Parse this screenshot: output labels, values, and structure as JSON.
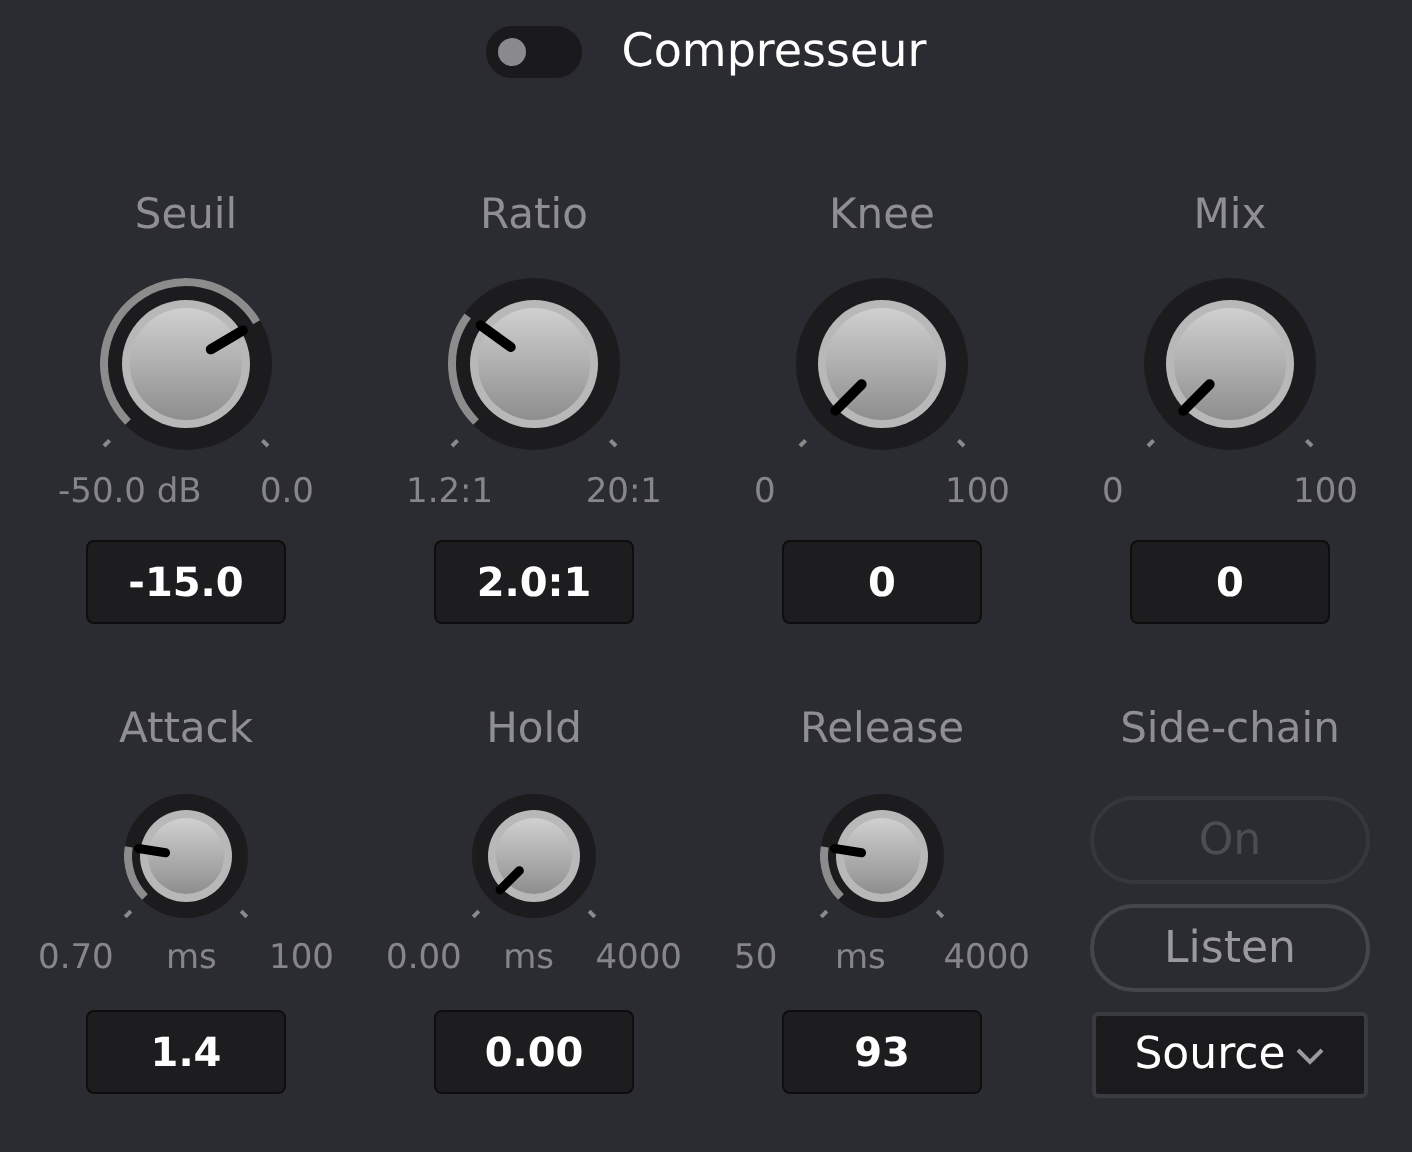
{
  "header": {
    "enabled": false,
    "title": "Compresseur"
  },
  "knobs_top": [
    {
      "label": "Seuil",
      "min": "-50.0 dB",
      "max": "0.0",
      "value": "-15.0"
    },
    {
      "label": "Ratio",
      "min": "1.2:1",
      "max": "20:1",
      "value": "2.0:1"
    },
    {
      "label": "Knee",
      "min": "0",
      "max": "100",
      "value": "0"
    },
    {
      "label": "Mix",
      "min": "0",
      "max": "100",
      "value": "0"
    }
  ],
  "knobs_bottom": [
    {
      "label": "Attack",
      "min": "0.70",
      "unit": "ms",
      "max": "100",
      "value": "1.4"
    },
    {
      "label": "Hold",
      "min": "0.00",
      "unit": "ms",
      "max": "4000",
      "value": "0.00"
    },
    {
      "label": "Release",
      "min": "50",
      "unit": "ms",
      "max": "4000",
      "value": "93"
    }
  ],
  "side_chain": {
    "label": "Side-chain",
    "buttons": [
      {
        "label": "On",
        "disabled": true
      },
      {
        "label": "Listen",
        "disabled": false
      }
    ],
    "source": {
      "value": "Source"
    }
  }
}
